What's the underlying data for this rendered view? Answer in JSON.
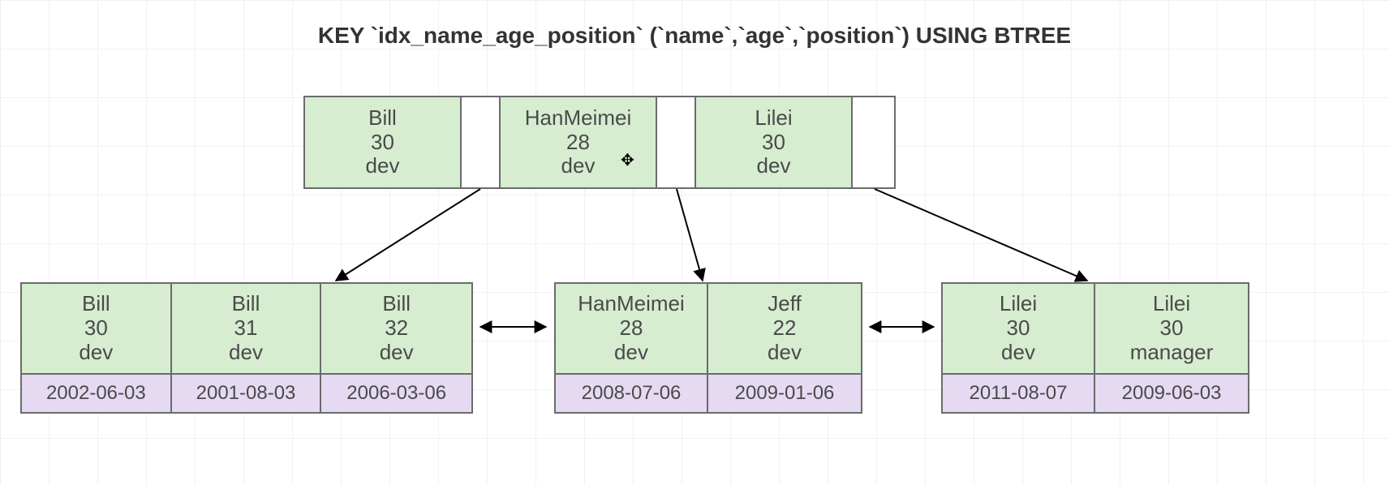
{
  "title": "KEY `idx_name_age_position` (`name`,`age`,`position`) USING BTREE",
  "root": {
    "keys": [
      {
        "name": "Bill",
        "age": "30",
        "position": "dev"
      },
      {
        "name": "HanMeimei",
        "age": "28",
        "position": "dev"
      },
      {
        "name": "Lilei",
        "age": "30",
        "position": "dev"
      }
    ]
  },
  "leaves": [
    {
      "keys": [
        {
          "name": "Bill",
          "age": "30",
          "position": "dev",
          "data": "2002-06-03"
        },
        {
          "name": "Bill",
          "age": "31",
          "position": "dev",
          "data": "2001-08-03"
        },
        {
          "name": "Bill",
          "age": "32",
          "position": "dev",
          "data": "2006-03-06"
        }
      ]
    },
    {
      "keys": [
        {
          "name": "HanMeimei",
          "age": "28",
          "position": "dev",
          "data": "2008-07-06"
        },
        {
          "name": "Jeff",
          "age": "22",
          "position": "dev",
          "data": "2009-01-06"
        }
      ]
    },
    {
      "keys": [
        {
          "name": "Lilei",
          "age": "30",
          "position": "dev",
          "data": "2011-08-07"
        },
        {
          "name": "Lilei",
          "age": "30",
          "position": "manager",
          "data": "2009-06-03"
        }
      ]
    }
  ],
  "colors": {
    "key_fill": "#d6edd0",
    "data_fill": "#e5daf2",
    "border": "#6b6b6b"
  }
}
